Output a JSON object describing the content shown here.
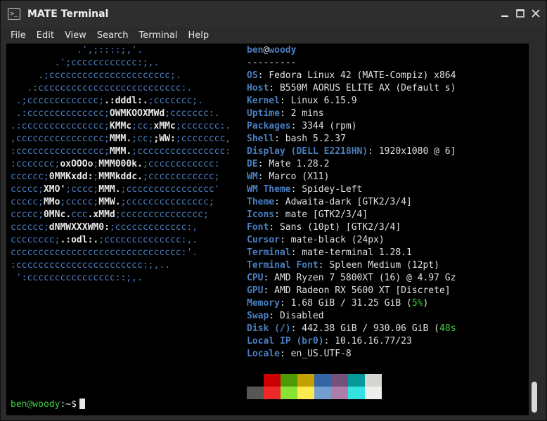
{
  "window": {
    "title": "MATE Terminal",
    "icon": "terminal-icon"
  },
  "menu": [
    "File",
    "Edit",
    "View",
    "Search",
    "Terminal",
    "Help"
  ],
  "logo_lines": [
    [
      {
        "t": "            .',;::::;,'.",
        "w": false
      }
    ],
    [
      {
        "t": "        .';cccccccccccc:;,.",
        "w": false
      }
    ],
    [
      {
        "t": "     .;cccccccccccccccccccccc;.",
        "w": false
      }
    ],
    [
      {
        "t": "   .:cccccccccccccccccccccccccc:.",
        "w": false
      }
    ],
    [
      {
        "t": " .;ccccccccccccc;",
        "w": false
      },
      {
        "t": ".:dddl:.",
        "w": true
      },
      {
        "t": ";ccccccc;.",
        "w": false
      }
    ],
    [
      {
        "t": " .:cccccccccccccc;",
        "w": false
      },
      {
        "t": "OWMKOOXMWd",
        "w": true
      },
      {
        "t": ";ccccccc:.",
        "w": false
      }
    ],
    [
      {
        "t": ".:ccccccccccccccc;",
        "w": false
      },
      {
        "t": "KMMc",
        "w": true
      },
      {
        "t": ";cc;",
        "w": false
      },
      {
        "t": "xMMc",
        "w": true
      },
      {
        "t": ";ccccccc:.",
        "w": false
      }
    ],
    [
      {
        "t": ",cccccccccccccccc;",
        "w": false
      },
      {
        "t": "MMM.",
        "w": true
      },
      {
        "t": ";cc;",
        "w": false
      },
      {
        "t": ";WW:",
        "w": true
      },
      {
        "t": ";cccccccc,",
        "w": false
      }
    ],
    [
      {
        "t": ":cccccccccccccccc;",
        "w": false
      },
      {
        "t": "MMM.",
        "w": true
      },
      {
        "t": ";cccccccccccccccc:",
        "w": false
      }
    ],
    [
      {
        "t": ":ccccccc;",
        "w": false
      },
      {
        "t": "oxOOOo",
        "w": true
      },
      {
        "t": ";",
        "w": false
      },
      {
        "t": "MMM000k.",
        "w": true
      },
      {
        "t": ";cccccccccccc:",
        "w": false
      }
    ],
    [
      {
        "t": "cccccc;",
        "w": false
      },
      {
        "t": "0MMKxdd:",
        "w": true
      },
      {
        "t": ";",
        "w": false
      },
      {
        "t": "MMMkddc.",
        "w": true
      },
      {
        "t": ";cccccccccccc;",
        "w": false
      }
    ],
    [
      {
        "t": "ccccc;",
        "w": false
      },
      {
        "t": "XMO'",
        "w": true
      },
      {
        "t": ";cccc;",
        "w": false
      },
      {
        "t": "MMM.",
        "w": true
      },
      {
        "t": ";cccccccccccccccc'",
        "w": false
      }
    ],
    [
      {
        "t": "ccccc;",
        "w": false
      },
      {
        "t": "MMo",
        "w": true
      },
      {
        "t": ";ccccc;",
        "w": false
      },
      {
        "t": "MMW.",
        "w": true
      },
      {
        "t": ";ccccccccccccccc;",
        "w": false
      }
    ],
    [
      {
        "t": "ccccc;",
        "w": false
      },
      {
        "t": "0MNc.",
        "w": true
      },
      {
        "t": "ccc",
        "w": false
      },
      {
        "t": ".xMMd",
        "w": true
      },
      {
        "t": ";ccccccccccccccc;",
        "w": false
      }
    ],
    [
      {
        "t": "cccccc;",
        "w": false
      },
      {
        "t": "dNMWXXXWM0:",
        "w": true
      },
      {
        "t": ";ccccccccccccc:,",
        "w": false
      }
    ],
    [
      {
        "t": "cccccccc;",
        "w": false
      },
      {
        "t": ".:odl:.",
        "w": true
      },
      {
        "t": ";cccccccccccccc:,.",
        "w": false
      }
    ],
    [
      {
        "t": "ccccccccccccccccccccccccccccccc:'.",
        "w": false
      }
    ],
    [
      {
        "t": ":ccccccccccccccccccccccc:;,..",
        "w": false
      }
    ],
    [
      {
        "t": " ':cccccccccccccccc::;,.",
        "w": false
      }
    ]
  ],
  "info": {
    "user": "ben",
    "at": "@",
    "host": "woody",
    "separator": "---------",
    "rows": [
      {
        "key": "OS",
        "value": "Fedora Linux 42 (MATE-Compiz) x864"
      },
      {
        "key": "Host",
        "value": "B550M AORUS ELITE AX (Default s)"
      },
      {
        "key": "Kernel",
        "value": "Linux 6.15.9"
      },
      {
        "key": "Uptime",
        "value": "2 mins"
      },
      {
        "key": "Packages",
        "value": "3344 (rpm)"
      },
      {
        "key": "Shell",
        "value": "bash 5.2.37"
      },
      {
        "key": "Display (DELL E2218HN)",
        "value": "1920x1080 @ 6]"
      },
      {
        "key": "DE",
        "value": "Mate 1.28.2"
      },
      {
        "key": "WM",
        "value": "Marco (X11)"
      },
      {
        "key": "WM Theme",
        "value": "Spidey-Left"
      },
      {
        "key": "Theme",
        "value": "Adwaita-dark [GTK2/3/4]"
      },
      {
        "key": "Icons",
        "value": "mate [GTK2/3/4]"
      },
      {
        "key": "Font",
        "value": "Sans (10pt) [GTK2/3/4]"
      },
      {
        "key": "Cursor",
        "value": "mate-black (24px)"
      },
      {
        "key": "Terminal",
        "value": "mate-terminal 1.28.1"
      },
      {
        "key": "Terminal Font",
        "value": "Spleen Medium (12pt)"
      },
      {
        "key": "CPU",
        "value": "AMD Ryzen 7 5800XT (16) @ 4.97 Gz"
      },
      {
        "key": "GPU",
        "value": "AMD Radeon RX 5600 XT [Discrete]"
      },
      {
        "key": "Memory",
        "value": "1.68 GiB / 31.25 GiB (",
        "hl": "5%",
        "tail": ")"
      },
      {
        "key": "Swap",
        "value": "Disabled"
      },
      {
        "key": "Disk (/)",
        "value": "442.38 GiB / 930.06 GiB (",
        "hl": "48s",
        "tail": ""
      },
      {
        "key": "Local IP (br0)",
        "value": "10.16.16.77/23"
      },
      {
        "key": "Locale",
        "value": "en_US.UTF-8"
      }
    ]
  },
  "palette": {
    "normal": [
      "#000000",
      "#cc0000",
      "#4e9a06",
      "#c4a000",
      "#3465a4",
      "#75507b",
      "#06989a",
      "#d3d7cf"
    ],
    "bright": [
      "#555753",
      "#ef2929",
      "#8ae234",
      "#fce94f",
      "#729fcf",
      "#ad7fa8",
      "#34e2e2",
      "#eeeeec"
    ]
  },
  "prompt": {
    "user": "ben@woody",
    "path": ":~$"
  }
}
